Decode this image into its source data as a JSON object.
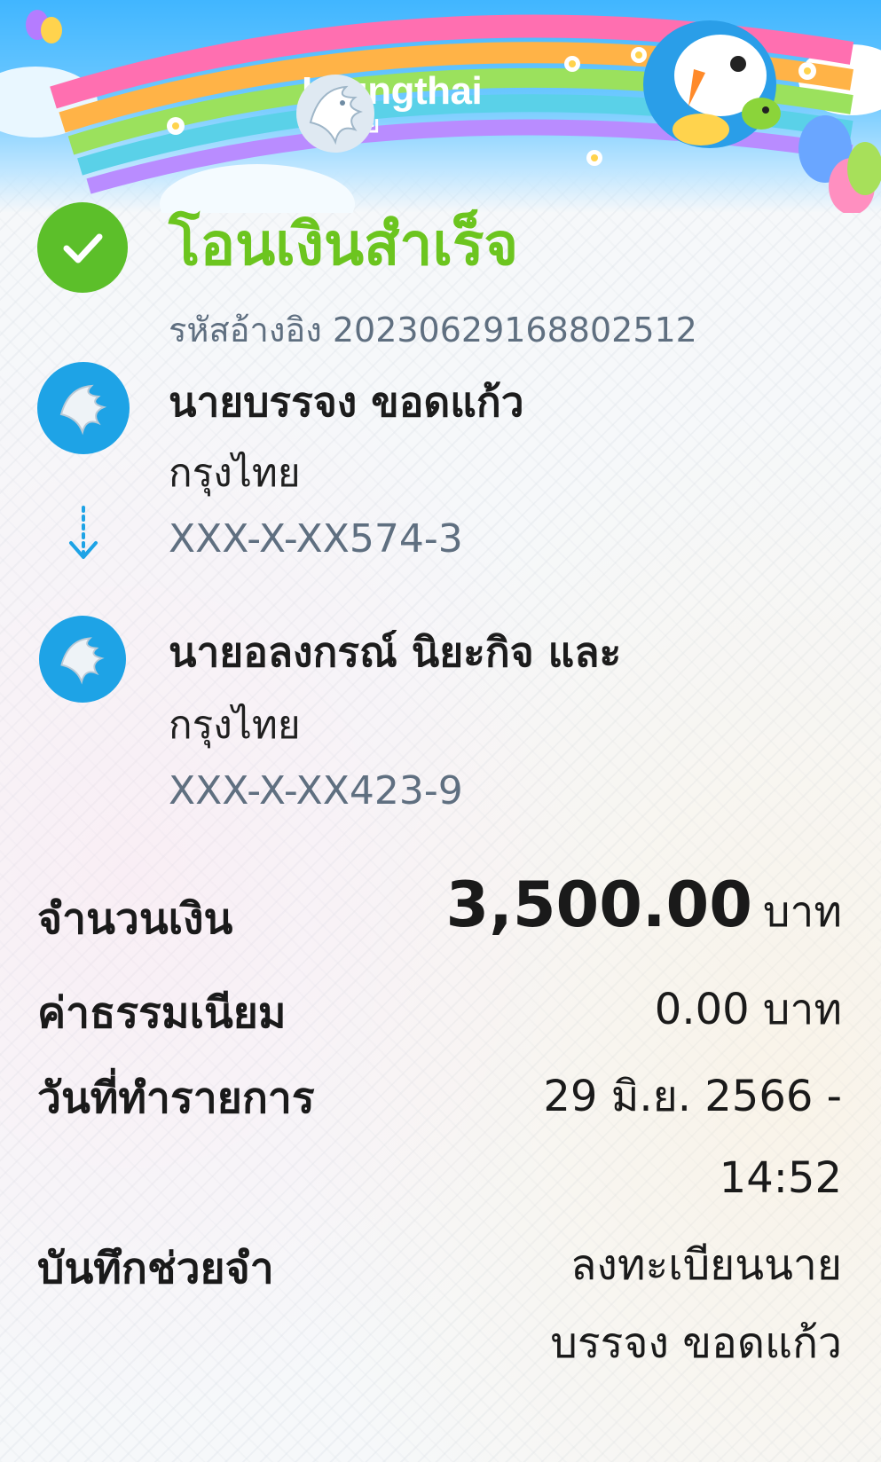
{
  "header": {
    "bank_name_en": "Krungthai",
    "bank_name_th": "กรุงไทย"
  },
  "status": {
    "title": "โอนเงินสำเร็จ",
    "ref_label": "รหัสอ้างอิง",
    "ref_number": "202306291688025 12"
  },
  "sender": {
    "name": "นายบรรจง ขอดแก้ว",
    "bank": "กรุงไทย",
    "account": "XXX-X-XX574-3"
  },
  "receiver": {
    "name": "นายอลงกรณ์ นิยะกิจ และ",
    "bank": "กรุงไทย",
    "account": "XXX-X-XX423-9"
  },
  "details": {
    "amount_label": "จำนวนเงิน",
    "amount_value": "3,500.00",
    "amount_unit": "บาท",
    "fee_label": "ค่าธรรมเนียม",
    "fee_value": "0.00 บาท",
    "date_label": "วันที่ทำรายการ",
    "date_value_line1": "29 มิ.ย. 2566 -",
    "date_value_line2": "14:52",
    "memo_label": "บันทึกช่วยจำ",
    "memo_value_line1": "ลงทะเบียนนาย",
    "memo_value_line2": "บรรจง ขอดแก้ว"
  },
  "colors": {
    "success_green": "#5cbf2a",
    "title_green": "#6cc51f",
    "bank_blue": "#1ea3e6",
    "muted_text": "#5f6f80"
  }
}
